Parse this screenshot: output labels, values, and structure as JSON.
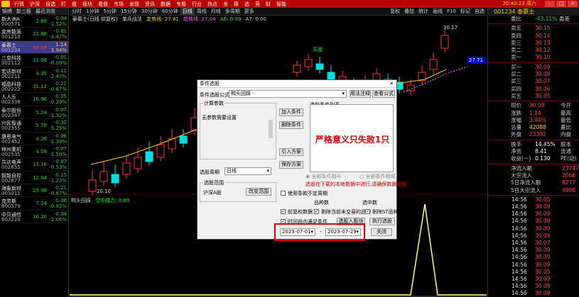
{
  "menubar": {
    "items": [
      "行情",
      "沪深",
      "自选",
      "盯",
      "盘",
      "板块",
      "看盘",
      "市场",
      "发现",
      "资讯",
      "数据",
      "专题",
      "行业",
      "热点",
      "龙",
      "择",
      "选",
      "竞",
      "财",
      "智能"
    ],
    "clock": "20:40:23 周六"
  },
  "left_list": {
    "headers": [
      "锦绣",
      "新三板",
      "最近浏览"
    ],
    "stocks": [
      {
        "name": "新大洲A",
        "code": "000571",
        "price": "2.60",
        "change": "-0.04",
        "pct": "-1.52%",
        "price_dir": "dn",
        "change_dir": "dn"
      },
      {
        "name": "金房能源",
        "code": "001210",
        "price": "22.88",
        "change": "-0.81",
        "pct": "-3.47%",
        "price_dir": "dn",
        "change_dir": "dn"
      },
      {
        "name": "泰慕士",
        "code": "001234",
        "price": "30.09",
        "change": "1.14",
        "pct": "3.94%",
        "price_dir": "up",
        "change_dir": "ylw",
        "selected": true
      },
      {
        "name": "三变科技",
        "code": "002112",
        "price": "11.06",
        "change": "-0.01",
        "pct": "-0.09%",
        "price_dir": "dn",
        "change_dir": "dn"
      },
      {
        "name": "宏达新材",
        "code": "002211",
        "price": "4.35",
        "change": "-0.11",
        "pct": "-2.47%",
        "price_dir": "dn",
        "change_dir": "dn"
      },
      {
        "name": "福晶科技",
        "code": "002222",
        "price": "31.12",
        "change": "-0.21",
        "pct": "-0.67%",
        "price_dir": "dn",
        "change_dir": "dn"
      },
      {
        "name": "人人乐",
        "code": "002336",
        "price": "16.96",
        "change": "-0.05",
        "pct": "-0.29%",
        "price_dir": "dn",
        "change_dir": "dn"
      },
      {
        "name": "泰尔股份",
        "code": "002347",
        "price": "5.24",
        "change": "-0.07",
        "pct": "-1.32%",
        "price_dir": "dn",
        "change_dir": "dn"
      },
      {
        "name": "兴民智通",
        "code": "002355",
        "price": "5.78",
        "change": "-0.32",
        "pct": "-5.25%",
        "price_dir": "dn",
        "change_dir": "dn"
      },
      {
        "name": "康恩电气",
        "code": "002452",
        "price": "4.26",
        "change": "-0.06",
        "pct": "-1.39%",
        "price_dir": "dn",
        "change_dir": "dn"
      },
      {
        "name": "林州重机",
        "code": "002535",
        "price": "4.59",
        "change": "-0.07",
        "pct": "-1.50%",
        "price_dir": "dn",
        "change_dir": "dn"
      },
      {
        "name": "共达电声",
        "code": "002655",
        "price": "13.16",
        "change": "-0.07",
        "pct": "-0.53%",
        "price_dir": "dn",
        "change_dir": "dn"
      },
      {
        "name": "智能自控",
        "code": "002877",
        "price": "12.04",
        "change": "-0.15",
        "pct": "-1.23%",
        "price_dir": "dn",
        "change_dir": "dn"
      },
      {
        "name": "海象新材",
        "code": "003011",
        "price": "23.98",
        "change": "-0.21",
        "pct": "-0.87%",
        "price_dir": "dn",
        "change_dir": "dn"
      },
      {
        "name": "克劳斯",
        "code": "600579",
        "price": "7.24",
        "change": "-0.06",
        "pct": "-0.82%",
        "price_dir": "dn",
        "change_dir": "dn"
      },
      {
        "name": "中贝通信",
        "code": "603220",
        "price": "16.20",
        "change": "-0.34",
        "pct": "-2.06%",
        "price_dir": "dn",
        "change_dir": "dn"
      }
    ]
  },
  "tabbar": {
    "tabs": [
      "分时",
      "1分钟",
      "5分钟",
      "15分钟",
      "30分钟",
      "60分钟",
      "日线",
      "周线",
      "月线",
      "多周期",
      "更多"
    ],
    "active": "日线",
    "right": [
      "复权",
      "叠加",
      "统计",
      "画线",
      "F10",
      "标记",
      "自选"
    ]
  },
  "infobar": {
    "title": "泰慕士(日线 前复权)",
    "indicator": "单兵战法",
    "line1": "走势线: 27.81",
    "line2": "趋势线: 27.04",
    "a6": "A6: 0.00",
    "a7": "A7: 0.00"
  },
  "chart_labels": {
    "high": "30.17",
    "low": "20.10",
    "buy_mark": "买出",
    "price_tag": "27.71"
  },
  "indicator_bar": {
    "name": "鸭头回踩",
    "text": "空中接力: 0.00"
  },
  "right_panel": {
    "title": "001234 泰慕士",
    "ratio_label": "委比",
    "ratio_value": "-43.11%",
    "ratio_extra": "委差",
    "asks": [
      {
        "label": "卖五",
        "price": "30.15"
      },
      {
        "label": "卖四",
        "price": "30.14"
      },
      {
        "label": "卖三",
        "price": "30.13"
      },
      {
        "label": "卖二",
        "price": "30.12"
      },
      {
        "label": "卖一",
        "price": "30.10"
      }
    ],
    "bids": [
      {
        "label": "买一",
        "price": "30.09"
      },
      {
        "label": "买二",
        "price": "30.08"
      },
      {
        "label": "买三",
        "price": "30.07"
      },
      {
        "label": "买四",
        "price": "30.06"
      },
      {
        "label": "买五",
        "price": "30.05"
      }
    ],
    "stats": [
      {
        "l": "现价",
        "v": "30.09",
        "l2": "今开",
        "dir": "up"
      },
      {
        "l": "涨跌",
        "v": "1.14",
        "l2": "最高",
        "dir": "up"
      },
      {
        "l": "涨幅",
        "v": "3.94%",
        "l2": "最低",
        "dir": "up"
      },
      {
        "l": "总量",
        "v": "42088",
        "l2": "量比",
        "dir": "ylw"
      },
      {
        "l": "外盘",
        "v": "23392",
        "l2": "内盘",
        "dir": "up"
      }
    ],
    "stats2": [
      {
        "l": "换手",
        "v": "14.45%",
        "l2": "股本"
      },
      {
        "l": "净资",
        "v": "8.41",
        "l2": "流通"
      },
      {
        "l": "收益(一)",
        "v": "0.130",
        "l2": "PE(动)"
      }
    ],
    "flows": [
      {
        "l": "净流入额",
        "v": "23747"
      },
      {
        "l": "大宗流入",
        "v": "2066"
      },
      {
        "l": "5日净流入额",
        "v": "8277"
      },
      {
        "l": "5日大宗流入",
        "v": "4988"
      }
    ],
    "ticks": [
      {
        "t": "14:56",
        "p": "30.05"
      },
      {
        "t": "14:56",
        "p": "30.09"
      },
      {
        "t": "14:56",
        "p": "30.09"
      },
      {
        "t": "14:56",
        "p": "30.09"
      },
      {
        "t": "14:56",
        "p": "30.09"
      },
      {
        "t": "14:56",
        "p": "30.09"
      },
      {
        "t": "14:56",
        "p": "30.07"
      },
      {
        "t": "14:56",
        "p": "30.09"
      },
      {
        "t": "14:56",
        "p": "30.09"
      },
      {
        "t": "14:56",
        "p": "30.09"
      },
      {
        "t": "14:56",
        "p": "30.05"
      },
      {
        "t": "14:56",
        "p": "30.09"
      },
      {
        "t": "14:56",
        "p": "30.09"
      },
      {
        "t": "14:56",
        "p": "30.09"
      },
      {
        "t": "14:56",
        "p": "30.05"
      }
    ]
  },
  "dialog": {
    "title": "条件选股",
    "formula_label": "条件选股公式",
    "formula_value": "鸭头回踩  -",
    "btn_usage": "用法注释",
    "btn_view": "查看公式",
    "calc_params": "计算参数",
    "no_params": "无参数需要设置",
    "condition_list": "选股条件列表",
    "btn_add": "加入条件",
    "btn_delete": "删除条件",
    "btn_import": "引入方案",
    "btn_save": "保存方案",
    "note_text": "严格意义只失败1只",
    "radio_all_and": "全部条件相与",
    "radio_all_or": "全部条件相或",
    "period_label": "选股周期",
    "period_value": "日线",
    "hint_text": "选股在下载的本地数据中进行,请确保数据完整",
    "range_label": "选股范围",
    "range_value": "沪深A股",
    "btn_range": "改变范围",
    "use_cycle": "使用条款不定周期",
    "stock_count_label": "品种数",
    "selected_count_label": "选中数",
    "prev_rights": "前复权数据",
    "exclude_suspended": "剔除当前未交易的品种",
    "exclude_st": "剔除ST品种",
    "time_range": "时间段内满足条件",
    "btn_add_block": "选股入板块",
    "btn_run": "执行选股",
    "date_from": "2023-07-01",
    "date_to": "2023-07-29",
    "btn_close": "关闭"
  }
}
